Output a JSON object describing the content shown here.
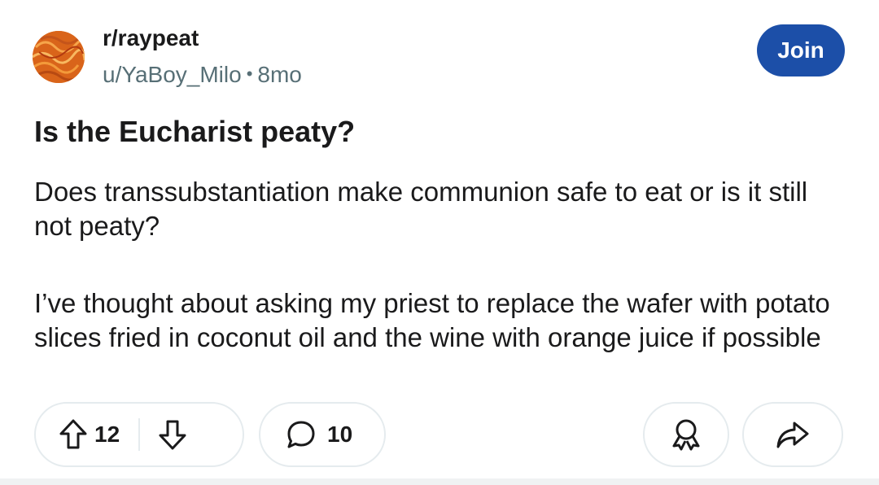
{
  "post": {
    "subreddit": "r/raypeat",
    "author": "u/YaBoy_Milo",
    "separator": "•",
    "age": "8mo",
    "join_label": "Join",
    "title": "Is the Eucharist peaty?",
    "body_paragraphs": [
      "Does transsubstantiation make communion safe to eat or is it still not peaty?",
      "I’ve thought about asking my priest to replace the wafer with potato slices fried in coconut oil and the wine with orange juice if possible"
    ]
  },
  "actions": {
    "upvote_count": "12",
    "comment_count": "10"
  },
  "icons": {
    "avatar": "subreddit-avatar-noodles",
    "upvote": "arrow-up-icon",
    "downvote": "arrow-down-icon",
    "comment": "speech-bubble-icon",
    "award": "award-ribbon-icon",
    "share": "share-arrow-icon"
  },
  "colors": {
    "join_button": "#1c4fa8",
    "meta_text": "#576f76",
    "pill_border": "#e5ebee",
    "avatar": "#e8781a"
  }
}
